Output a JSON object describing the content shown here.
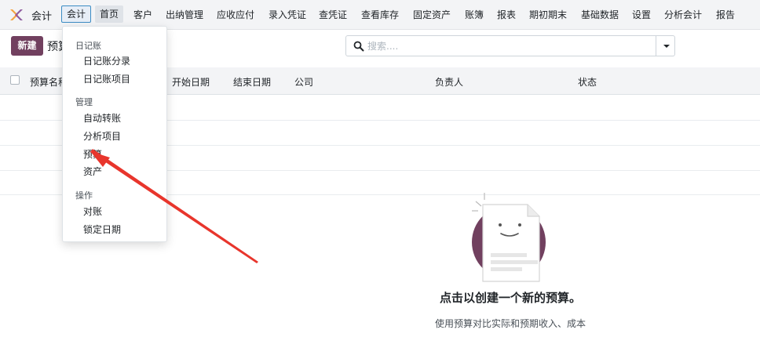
{
  "app": {
    "name": "会计"
  },
  "navbar": {
    "items": [
      "会计",
      "首页",
      "客户",
      "出纳管理",
      "应收应付",
      "录入凭证",
      "查凭证",
      "查看库存",
      "固定资产",
      "账簿",
      "报表",
      "期初期末",
      "基础数据",
      "设置",
      "分析会计",
      "报告"
    ]
  },
  "control_panel": {
    "new_button": "新建",
    "breadcrumb": "预算"
  },
  "search": {
    "placeholder": "搜索...."
  },
  "list": {
    "columns": [
      "预算名称",
      "开始日期",
      "结束日期",
      "公司",
      "负责人",
      "状态"
    ]
  },
  "empty_state": {
    "title": "点击以创建一个新的预算。",
    "description": "使用预算对比实际和预期收入、成本"
  },
  "dropdown": {
    "sections": [
      {
        "header": "日记账",
        "items": [
          "日记账分录",
          "日记账项目"
        ]
      },
      {
        "header": "管理",
        "items": [
          "自动转账",
          "分析项目",
          "预算",
          "资产"
        ]
      },
      {
        "header": "操作",
        "items": [
          "对账",
          "锁定日期"
        ]
      }
    ]
  },
  "colors": {
    "primary": "#71405f",
    "annotation": "#e8352c",
    "active_border": "#3b8cc4"
  },
  "icons": {
    "logo": "odoo-accounting-logo",
    "search": "search-icon",
    "caret": "caret-down-icon"
  }
}
